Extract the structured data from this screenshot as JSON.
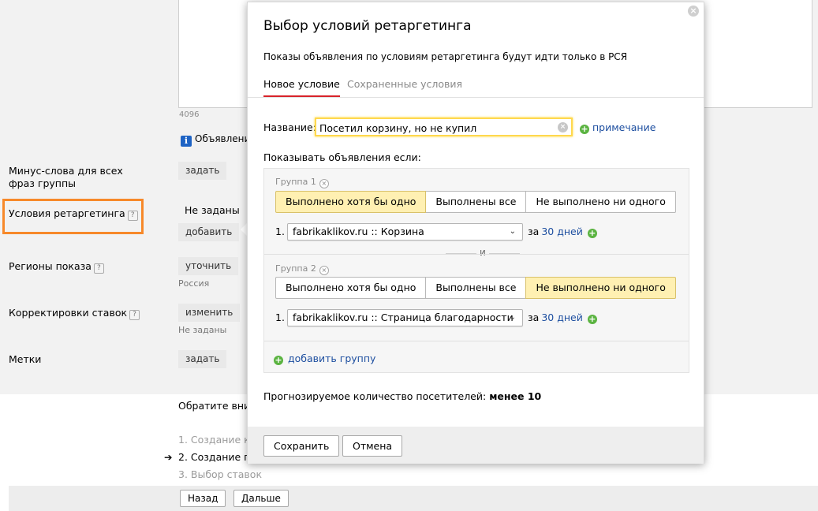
{
  "background": {
    "counter": "4096",
    "info_text": "Объявлени",
    "rows": {
      "minus_words": {
        "label": "Минус-слова для всех фраз группы",
        "button": "задать"
      },
      "retargeting": {
        "label": "Условия ретаргетинга",
        "value": "Не заданы",
        "button": "добавить"
      },
      "regions": {
        "label": "Регионы показа",
        "button": "уточнить",
        "sub": "Россия"
      },
      "bid_adjust": {
        "label": "Корректировки ставок",
        "button": "изменить",
        "sub": "Не заданы"
      },
      "tags": {
        "label": "Метки",
        "button": "задать"
      }
    },
    "notice": "Обратите вним",
    "steps": [
      {
        "text": "1. Создание к",
        "state": "done"
      },
      {
        "text": "2. Создание гр",
        "state": "current"
      },
      {
        "text": "3. Выбор ставок",
        "state": "pending"
      }
    ],
    "back_button": "Назад",
    "next_button": "Дальше",
    "highlight_color": "#f7892a"
  },
  "modal": {
    "title": "Выбор условий ретаргетинга",
    "subtitle": "Показы объявления по условиям ретаргетинга будут идти только в РСЯ",
    "tabs": [
      {
        "label": "Новое условие",
        "active": true
      },
      {
        "label": "Сохраненные условия",
        "active": false
      }
    ],
    "name_label": "Название:",
    "name_value": "Посетил корзину, но не купил",
    "note_link": "примечание",
    "show_if_label": "Показывать объявления если:",
    "groups": [
      {
        "title": "Группа 1",
        "options": [
          "Выполнено хотя бы одно",
          "Выполнены все",
          "Не выполнено ни одного"
        ],
        "selected": 0,
        "condition": {
          "num": "1.",
          "goal": "fabrikaklikov.ru :: Корзина",
          "for": "за",
          "days": "30 дней"
        }
      },
      {
        "title": "Группа 2",
        "options": [
          "Выполнено хотя бы одно",
          "Выполнены все",
          "Не выполнено ни одного"
        ],
        "selected": 2,
        "condition": {
          "num": "1.",
          "goal": "fabrikaklikov.ru :: Страница благодарности",
          "for": "за",
          "days": "30 дней"
        }
      }
    ],
    "and_label": "и",
    "add_group": "добавить группу",
    "forecast_label": "Прогнозируемое количество посетителей:",
    "forecast_value": "менее 10",
    "save_button": "Сохранить",
    "cancel_button": "Отмена",
    "accent_color": "#d8232a",
    "selected_bg": "#fff0b2"
  }
}
